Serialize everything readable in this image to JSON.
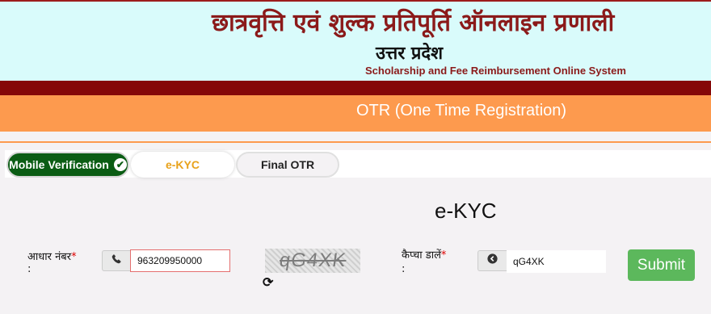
{
  "header": {
    "title_hindi": "छात्रवृत्ति एवं शुल्क प्रतिपूर्ति ऑनलाइन प्रणाली",
    "state": "उत्तर प्रदेश",
    "title_english": "Scholarship and Fee Reimbursement Online System"
  },
  "banner": {
    "otr": "OTR (One Time Registration)"
  },
  "steps": [
    {
      "label": "Mobile Verification",
      "status": "completed",
      "check": "✔"
    },
    {
      "label": "e-KYC",
      "status": "active"
    },
    {
      "label": "Final OTR",
      "status": "pending"
    }
  ],
  "form": {
    "heading": "e-KYC",
    "aadhar": {
      "label": "आधार नंबर",
      "required": "*",
      "colon": ":",
      "value": "963209950000",
      "icon": "phone-icon"
    },
    "captcha_image_text": "qG4XK",
    "refresh_icon": "refresh-icon",
    "captcha": {
      "label": "कैप्चा डालें",
      "required": "*",
      "colon": ":",
      "value": "qG4XK",
      "icon": "arrow-circle-icon"
    },
    "submit_label": "Submit"
  },
  "colors": {
    "maroon": "#850808",
    "orange": "#fd9a4e",
    "header_bg": "#d9fbfb",
    "green_step": "#0b5d14",
    "submit": "#5cb85c",
    "ekyc_text": "#e8a21b"
  }
}
